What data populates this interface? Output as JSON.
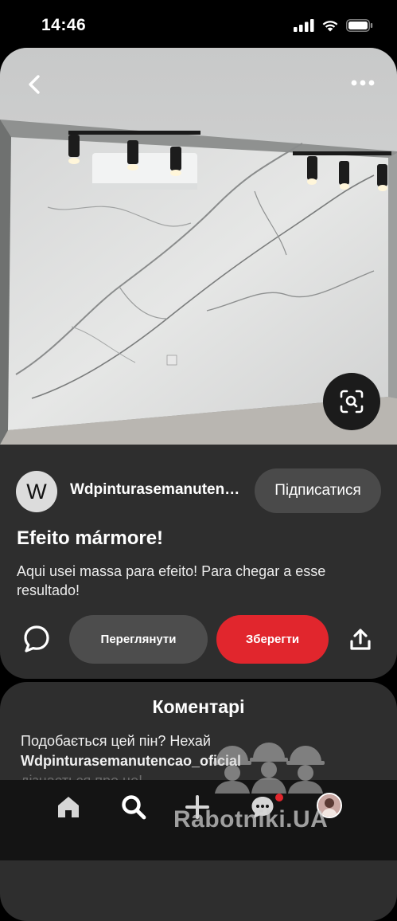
{
  "status": {
    "time": "14:46"
  },
  "pin": {
    "creator_initial": "W",
    "creator_name": "Wdpinturasemanutencao_oficial",
    "follow_label": "Підписатися",
    "title": "Efeito mármore!",
    "description": "Aqui usei massa para efeito! Para chegar a esse resultado!",
    "view_label": "Переглянути",
    "save_label": "Зберегти"
  },
  "comments": {
    "title": "Коментарі",
    "prompt_prefix": "Подобається цей пін? Нехай",
    "prompt_user": "Wdpinturasemanutencao_oficial",
    "prompt_suffix": "дізнається про це!"
  },
  "watermark": "Rabotniki.UA",
  "icons": {
    "back": "chevron-left-icon",
    "more": "more-horizontal-icon",
    "lens": "visual-search-icon",
    "comment": "comment-bubble-icon",
    "share": "share-upload-icon",
    "home": "home-icon",
    "search": "search-icon",
    "create": "plus-icon",
    "messages": "chat-bubble-icon"
  },
  "colors": {
    "save": "#e1262d",
    "card": "#2e2e2e",
    "background": "#000000"
  }
}
